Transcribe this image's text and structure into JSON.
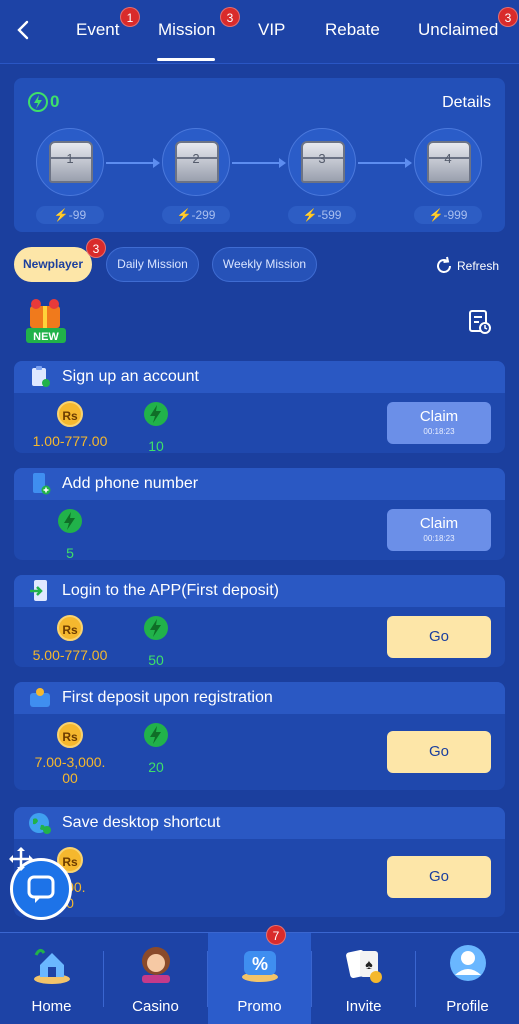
{
  "tabs": [
    {
      "label": "Event",
      "badge": "1"
    },
    {
      "label": "Mission",
      "badge": "3"
    },
    {
      "label": "VIP",
      "badge": ""
    },
    {
      "label": "Rebate",
      "badge": ""
    },
    {
      "label": "Unclaimed",
      "badge": "3"
    }
  ],
  "chests": {
    "energy_total": "0",
    "details_label": "Details",
    "items": [
      {
        "num": "1",
        "cost": "-99"
      },
      {
        "num": "2",
        "cost": "-299"
      },
      {
        "num": "3",
        "cost": "-599"
      },
      {
        "num": "4",
        "cost": "-999"
      }
    ]
  },
  "mission_tabs": [
    {
      "label": "Newplayer",
      "badge": "3"
    },
    {
      "label": "Daily Mission"
    },
    {
      "label": "Weekly Mission"
    }
  ],
  "refresh_label": "Refresh",
  "new_label": "NEW",
  "missions": [
    {
      "title": "Sign up an account",
      "currency": "Rs",
      "rs": "1.00-777.00",
      "energy": "10",
      "button": "Claim",
      "timer": "00:18:23"
    },
    {
      "title": "Add phone number",
      "energy": "5",
      "button": "Claim",
      "timer": "00:18:23"
    },
    {
      "title": "Login to the APP(First deposit)",
      "currency": "Rs",
      "rs": "5.00-777.00",
      "energy": "50",
      "button": "Go"
    },
    {
      "title": "First deposit upon registration",
      "currency": "Rs",
      "rs_line1": "7.00-3,000.",
      "rs_line2": "00",
      "energy": "20",
      "button": "Go"
    },
    {
      "title": "Save desktop shortcut",
      "currency": "Rs",
      "rs_line1": ",000.",
      "rs_line2": "0",
      "button": "Go"
    }
  ],
  "nav": [
    {
      "label": "Home"
    },
    {
      "label": "Casino"
    },
    {
      "label": "Promo",
      "badge": "7"
    },
    {
      "label": "Invite"
    },
    {
      "label": "Profile"
    }
  ],
  "colors": {
    "background": "#1b3f9e",
    "card": "#1f48ad",
    "accent_yellow": "#fde6a8",
    "energy_green": "#3ee069",
    "coin_gold": "#f5b82e",
    "badge_red": "#d92b2b"
  }
}
